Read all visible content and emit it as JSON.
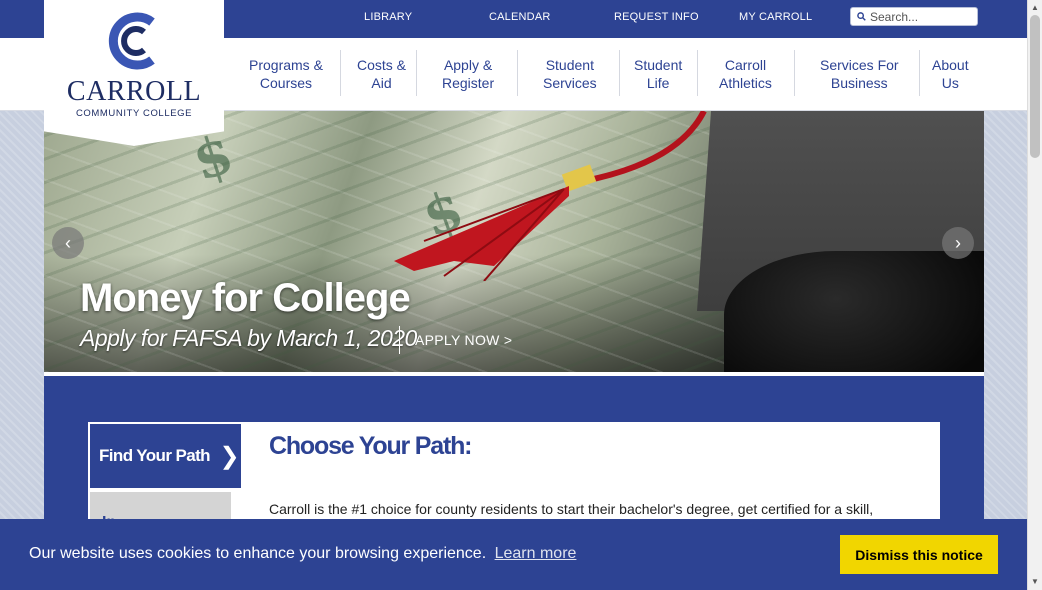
{
  "utility_nav": {
    "library": "LIBRARY",
    "calendar": "CALENDAR",
    "request_info": "REQUEST INFO",
    "my_carroll": "MY CARROLL",
    "search_placeholder": "Search..."
  },
  "logo": {
    "name": "CARROLL",
    "subtitle": "COMMUNITY COLLEGE"
  },
  "main_nav": [
    {
      "line1": "Programs &",
      "line2": "Courses"
    },
    {
      "line1": "Costs &",
      "line2": "Aid"
    },
    {
      "line1": "Apply &",
      "line2": "Register"
    },
    {
      "line1": "Student",
      "line2": "Services"
    },
    {
      "line1": "Student",
      "line2": "Life"
    },
    {
      "line1": "Carroll",
      "line2": "Athletics"
    },
    {
      "line1": "Services For",
      "line2": "Business"
    },
    {
      "line1": "About",
      "line2": "Us"
    }
  ],
  "hero": {
    "title": "Money for College",
    "subtitle": "Apply for FAFSA by March 1, 2020",
    "cta": "APPLY NOW  >"
  },
  "path_section": {
    "active_tab": "Find Your Path",
    "next_tab": "In",
    "heading": "Choose Your Path:",
    "body": "Carroll is the #1 choice for county residents to start their bachelor's degree, get certified for a skill,"
  },
  "cookie_banner": {
    "message": "Our website uses cookies to enhance your browsing experience.",
    "learn_more": "Learn more",
    "dismiss": "Dismiss this notice"
  },
  "colors": {
    "brand_blue": "#2d4393",
    "cookie_button": "#f1d600"
  }
}
